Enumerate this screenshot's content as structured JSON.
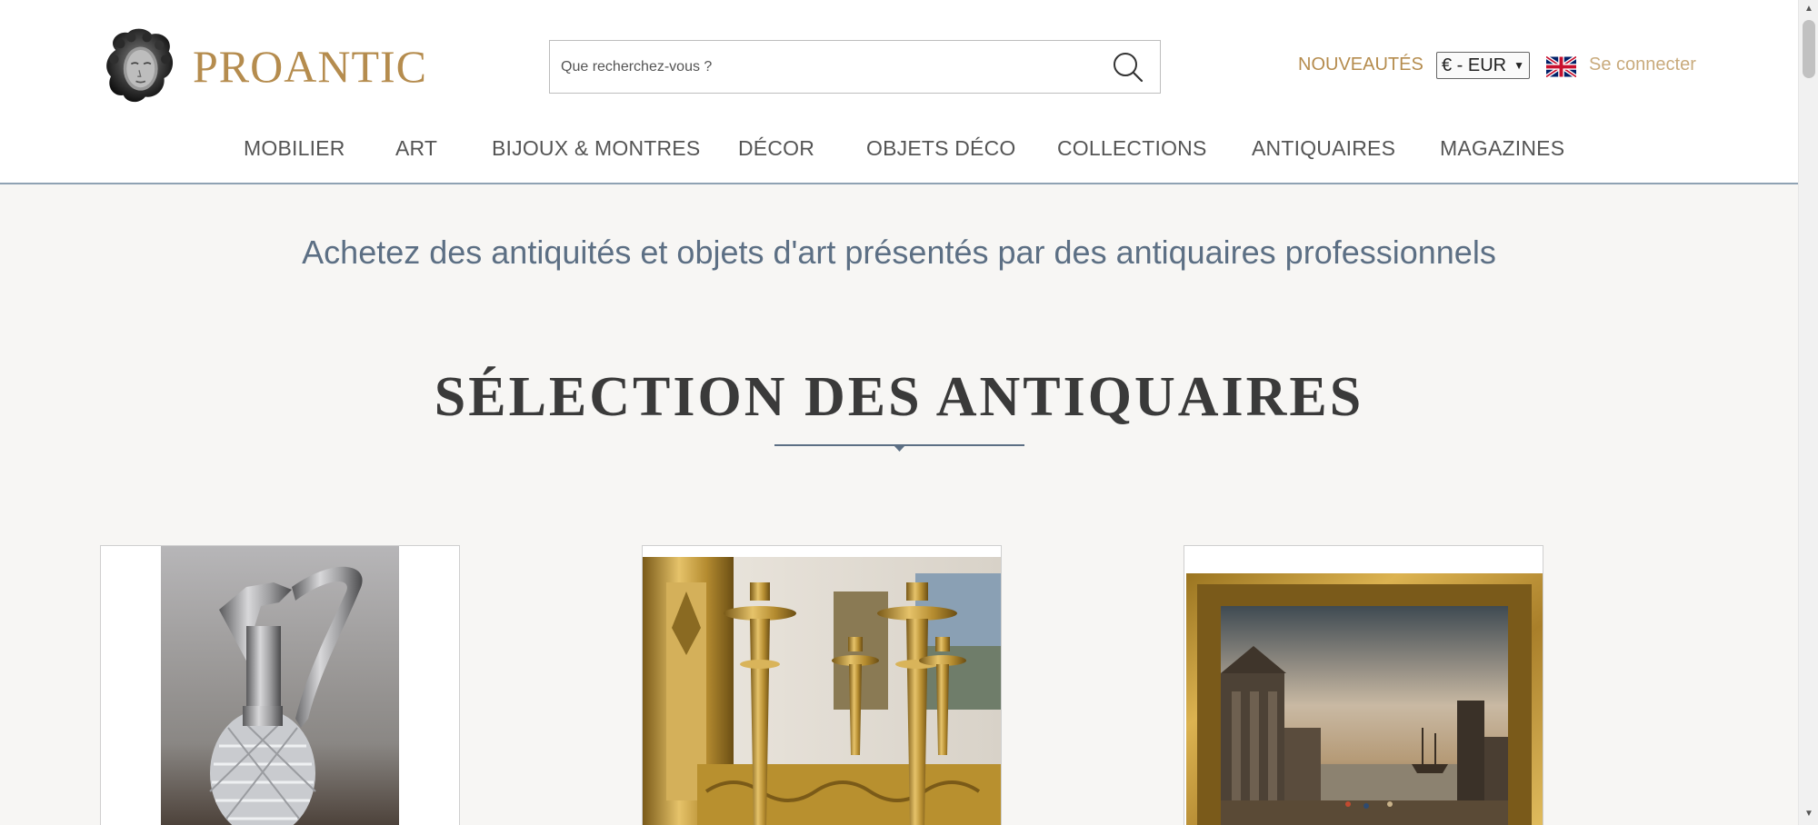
{
  "header": {
    "logo_text": "PROANTIC",
    "search_placeholder": "Que recherchez-vous ?",
    "nouveautes": "NOUVEAUTÉS",
    "currency": "€ - EUR",
    "login": "Se connecter",
    "accent_color": "#b58c4e"
  },
  "nav": {
    "items": [
      {
        "label": "MOBILIER"
      },
      {
        "label": "ART"
      },
      {
        "label": "BIJOUX & MONTRES"
      },
      {
        "label": "DÉCOR"
      },
      {
        "label": "OBJETS DÉCO"
      },
      {
        "label": "COLLECTIONS"
      },
      {
        "label": "ANTIQUAIRES"
      },
      {
        "label": "MAGAZINES"
      }
    ]
  },
  "main": {
    "tagline": "Achetez des antiquités et objets d'art présentés par des antiquaires professionnels",
    "section_title": "SÉLECTION DES ANTIQUAIRES",
    "products": [
      {
        "image": "silver-crystal-ewer"
      },
      {
        "image": "gilt-bronze-candlesticks"
      },
      {
        "image": "framed-harbour-painting"
      }
    ]
  }
}
